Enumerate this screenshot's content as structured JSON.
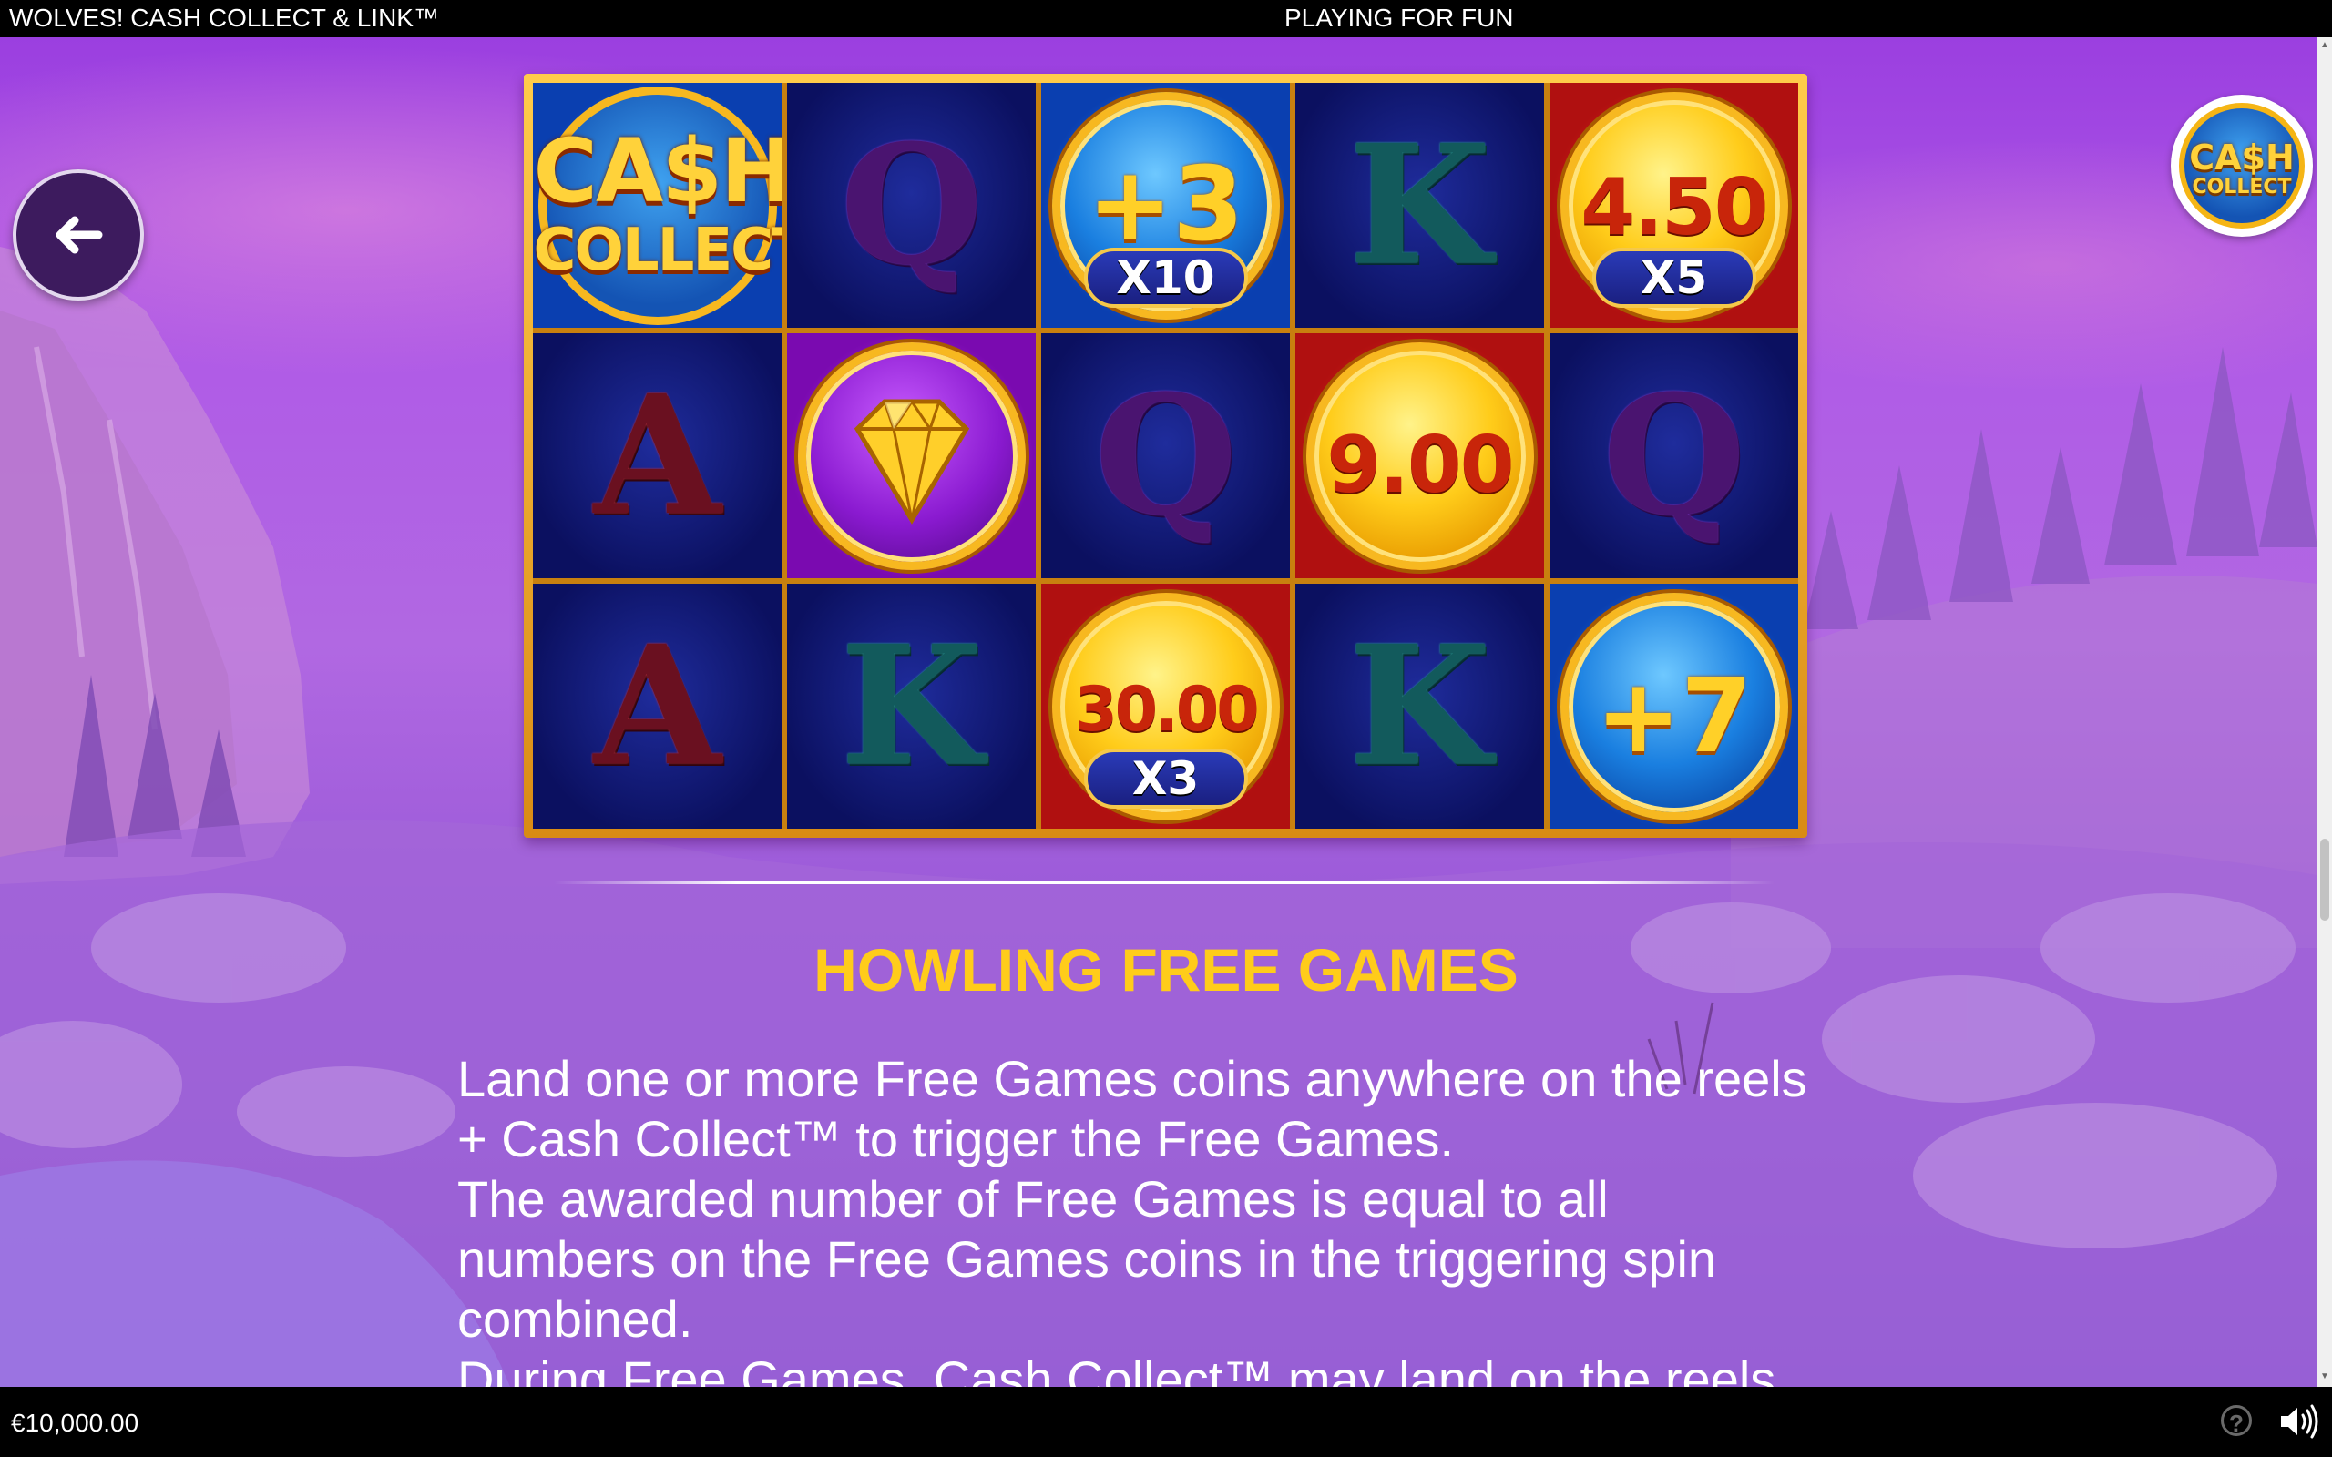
{
  "topbar": {
    "title": "WOLVES! CASH COLLECT & LINK™",
    "mode": "PLAYING FOR FUN"
  },
  "logo": {
    "line1": "CA$H",
    "line2": "COLLECT"
  },
  "reels": {
    "row1": {
      "c1": {
        "line1": "CA$H",
        "line2": "COLLECT"
      },
      "c2": "Q",
      "c3": {
        "plus": "+3",
        "mult": "X10"
      },
      "c4": "K",
      "c5": {
        "value": "4.50",
        "mult": "X5"
      }
    },
    "row2": {
      "c1": "A",
      "c2": "diamond",
      "c3": "Q",
      "c4": {
        "value": "9.00"
      },
      "c5": "Q"
    },
    "row3": {
      "c1": "A",
      "c2": "K",
      "c3": {
        "value": "30.00",
        "mult": "X3"
      },
      "c4": "K",
      "c5": {
        "plus": "+7"
      }
    }
  },
  "section": {
    "title": "HOWLING FREE GAMES",
    "lines": [
      "Land one or more Free Games coins anywhere on the reels",
      "+ Cash Collect™ to trigger the Free Games.",
      "The awarded number of Free Games is equal to all",
      "numbers on the Free Games coins in the triggering spin",
      "combined.",
      "During Free Games, Cash Collect™ may land on the reels"
    ]
  },
  "footer": {
    "balance": "€10,000.00"
  },
  "icons": {
    "back": "arrow-left-icon",
    "help": "question-mark-icon",
    "sound": "speaker-icon",
    "gem": "diamond-icon"
  },
  "colors": {
    "title_gold": "#ffcc1a",
    "bar": "#000000",
    "back_button": "#3d1b5e"
  }
}
